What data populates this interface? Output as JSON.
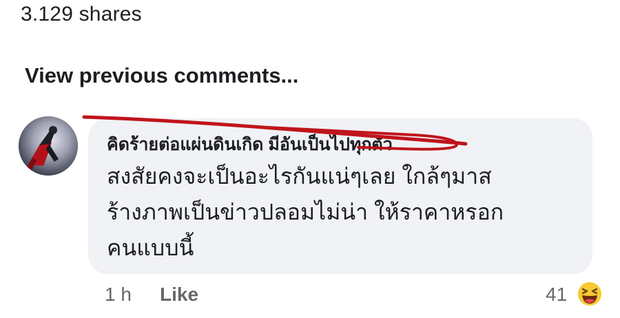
{
  "post": {
    "shares_text": "3.129 shares"
  },
  "comments_section": {
    "view_previous_label": "View previous comments..."
  },
  "comment": {
    "author": "คิดร้ายต่อแผ่นดินเกิด มีอันเป็นไปทุกตัว",
    "text_lines": [
      "สงสัยคงจะเป็นอะไรกันแน่ๆเลย ใกล้ๆมาส",
      "ร้างภาพเป็นข่าวปลอมไม่น่า ให้ราคาหรอก",
      "คนแบบนี้"
    ],
    "time": "1 h",
    "like_label": "Like",
    "reaction_count": "41",
    "reaction_icon": "haha-emoji-icon",
    "colors": {
      "bubble": "#f0f2f5",
      "scribble": "#c0141c",
      "reaction": "#f7c934"
    }
  }
}
